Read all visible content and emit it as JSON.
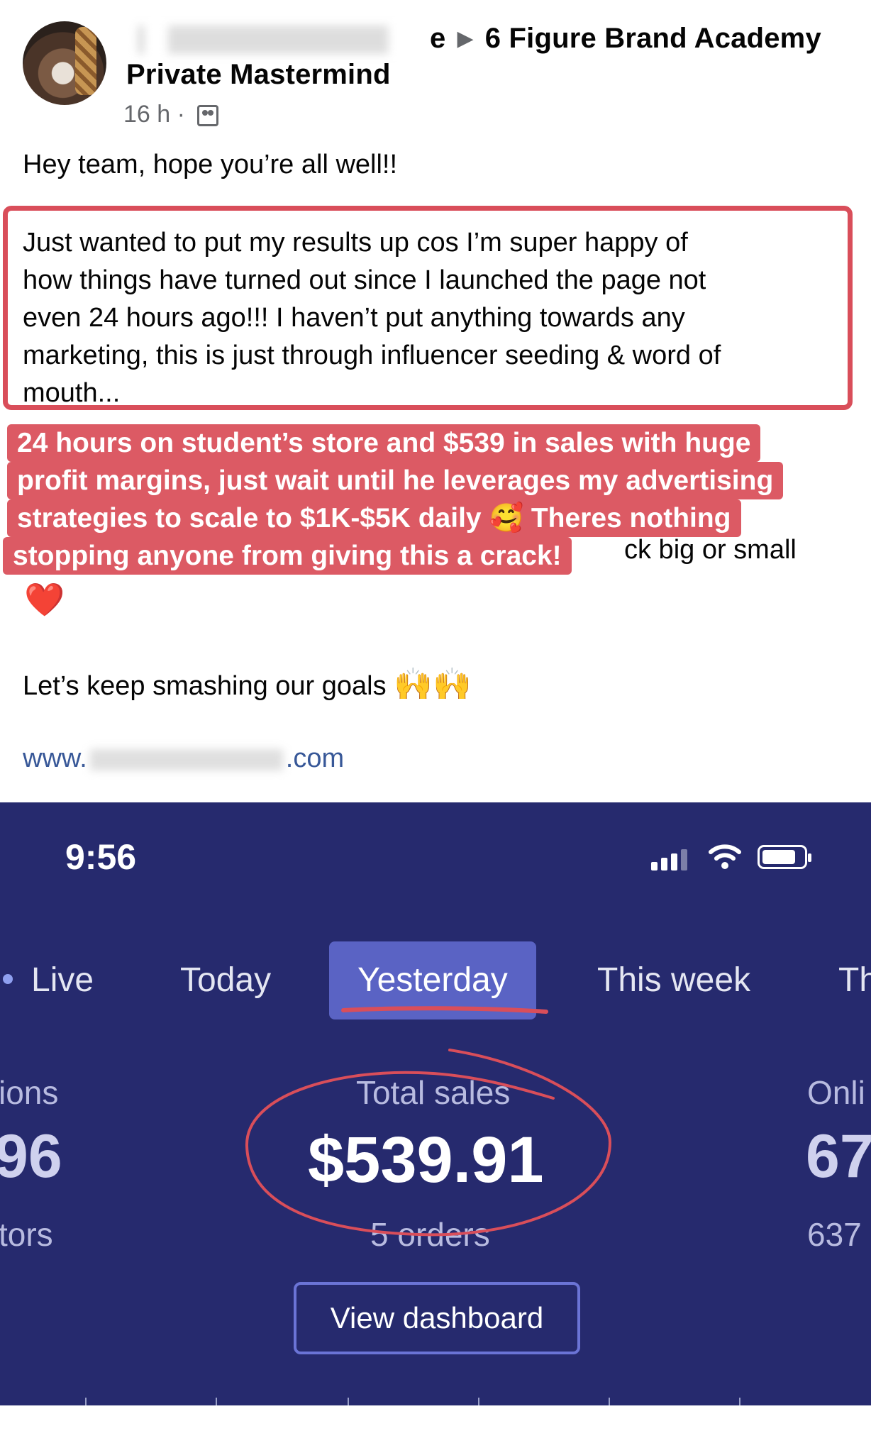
{
  "post": {
    "author_suffix": "e",
    "group_name": "6 Figure Brand Academy",
    "group_name_line2": "Private Mastermind",
    "time_ago": "16 h",
    "meta_separator": "·",
    "greeting": "Hey team, hope you’re all well!!",
    "results_lines": [
      "Just wanted to put my results up cos I’m super happy of",
      "how things have turned out since I launched the page not",
      "even 24 hours ago!!! I haven’t put anything towards any",
      "marketing, this is just through influencer seeding & word of",
      "mouth..."
    ],
    "hidden_text_fragment": "ck big or small",
    "heart_emoji": "❤️",
    "goals_text": "Let’s keep smashing our goals",
    "goals_emoji": "🙌🙌",
    "link_prefix": "www.",
    "link_suffix": ".com"
  },
  "overlay": {
    "lines": [
      "24 hours on student’s store and $539 in sales with huge",
      "profit margins, just wait until he leverages my advertising",
      "strategies to scale to $1K-$5K daily 🥰 Theres nothing",
      "stopping anyone from giving this a crack!"
    ],
    "color": "#dc5a64"
  },
  "phone": {
    "time": "9:56",
    "tabs": [
      "Live",
      "Today",
      "Yesterday",
      "This week",
      "Th"
    ],
    "active_tab": "Yesterday",
    "left_metric": {
      "label": "ions",
      "value": "96",
      "sub": "tors"
    },
    "center_metric": {
      "label": "Total sales",
      "value": "$539.91",
      "sub": "5 orders"
    },
    "right_metric": {
      "label": "Onli",
      "value": "67",
      "sub": "637"
    },
    "button": "View dashboard",
    "background": "#262a6e",
    "annotation_color": "#d94e5a"
  }
}
